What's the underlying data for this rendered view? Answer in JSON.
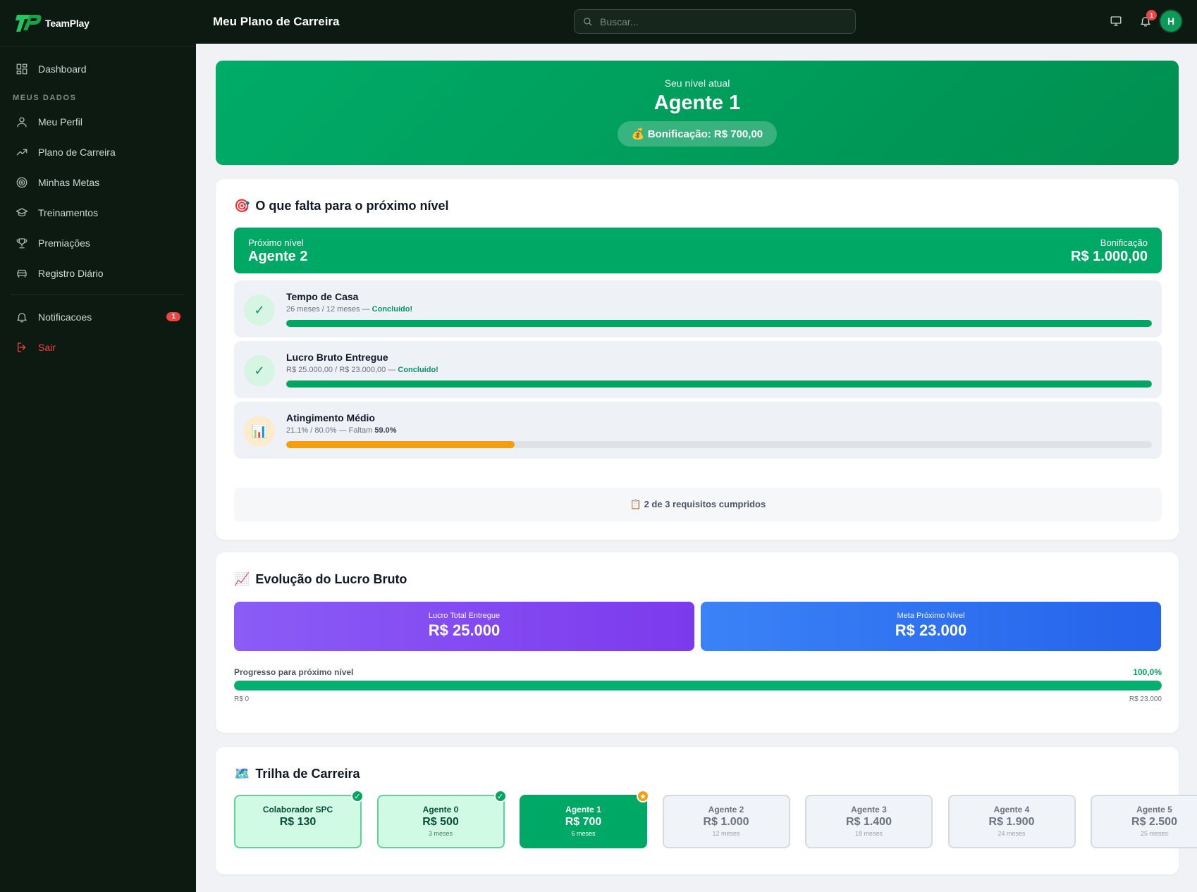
{
  "brand": {
    "name": "TeamPlay"
  },
  "sidebar": {
    "dashboard": "Dashboard",
    "section_label": "MEUS DADOS",
    "items": [
      "Meu Perfil",
      "Plano de Carreira",
      "Minhas Metas",
      "Treinamentos",
      "Premiações",
      "Registro Diário"
    ],
    "notifications": "Notificacoes",
    "notifications_count": "1",
    "logout": "Sair"
  },
  "header": {
    "title": "Meu Plano de Carreira",
    "search_placeholder": "Buscar...",
    "bell_count": "1",
    "avatar_initial": "H"
  },
  "hero": {
    "label": "Seu nível atual",
    "level": "Agente 1",
    "bonus": "💰 Bonificação: R$ 700,00"
  },
  "next_level": {
    "title": "O que falta para o próximo nível",
    "title_icon": "🎯",
    "label": "Próximo nível",
    "name": "Agente 2",
    "bonus_label": "Bonificação",
    "bonus_value": "R$ 1.000,00",
    "requirements": [
      {
        "title": "Tempo de Casa",
        "detail": "26 meses / 12 meses — ",
        "status": "Concluído!",
        "progress": 100,
        "done": true,
        "icon": "✓"
      },
      {
        "title": "Lucro Bruto Entregue",
        "detail": "R$ 25.000,00 / R$ 23.000,00 — ",
        "status": "Concluído!",
        "progress": 100,
        "done": true,
        "icon": "✓"
      },
      {
        "title": "Atingimento Médio",
        "detail": "21.1% / 80.0% — Faltam ",
        "status": "59.0%",
        "progress": 26.4,
        "done": false,
        "icon": "📊"
      }
    ],
    "summary": "📋 2 de 3 requisitos cumpridos"
  },
  "evolution": {
    "title": "Evolução do Lucro Bruto",
    "title_icon": "📈",
    "total_label": "Lucro Total Entregue",
    "total_value": "R$ 25.000",
    "goal_label": "Meta Próximo Nível",
    "goal_value": "R$ 23.000",
    "progress_label": "Progresso para próximo nível",
    "progress_pct": "100,0%",
    "progress": 100,
    "min_label": "R$ 0",
    "max_label": "R$ 23.000"
  },
  "trail": {
    "title": "Trilha de Carreira",
    "title_icon": "🗺️",
    "steps": [
      {
        "name": "Colaborador SPC",
        "value": "R$ 130",
        "sub": "",
        "state": "done"
      },
      {
        "name": "Agente 0",
        "value": "R$ 500",
        "sub": "3 meses",
        "state": "done"
      },
      {
        "name": "Agente 1",
        "value": "R$ 700",
        "sub": "6 meses",
        "state": "current"
      },
      {
        "name": "Agente 2",
        "value": "R$ 1.000",
        "sub": "12 meses",
        "state": "locked"
      },
      {
        "name": "Agente 3",
        "value": "R$ 1.400",
        "sub": "18 meses",
        "state": "locked"
      },
      {
        "name": "Agente 4",
        "value": "R$ 1.900",
        "sub": "24 meses",
        "state": "locked"
      },
      {
        "name": "Agente 5",
        "value": "R$ 2.500",
        "sub": "25 meses",
        "state": "locked"
      }
    ]
  },
  "colors": {
    "sidebar_bg": "#0c1a12",
    "accent": "#00a865",
    "danger": "#ef4444",
    "warning": "#f59e0b",
    "purple": "#7c3aed",
    "blue": "#2563eb"
  }
}
